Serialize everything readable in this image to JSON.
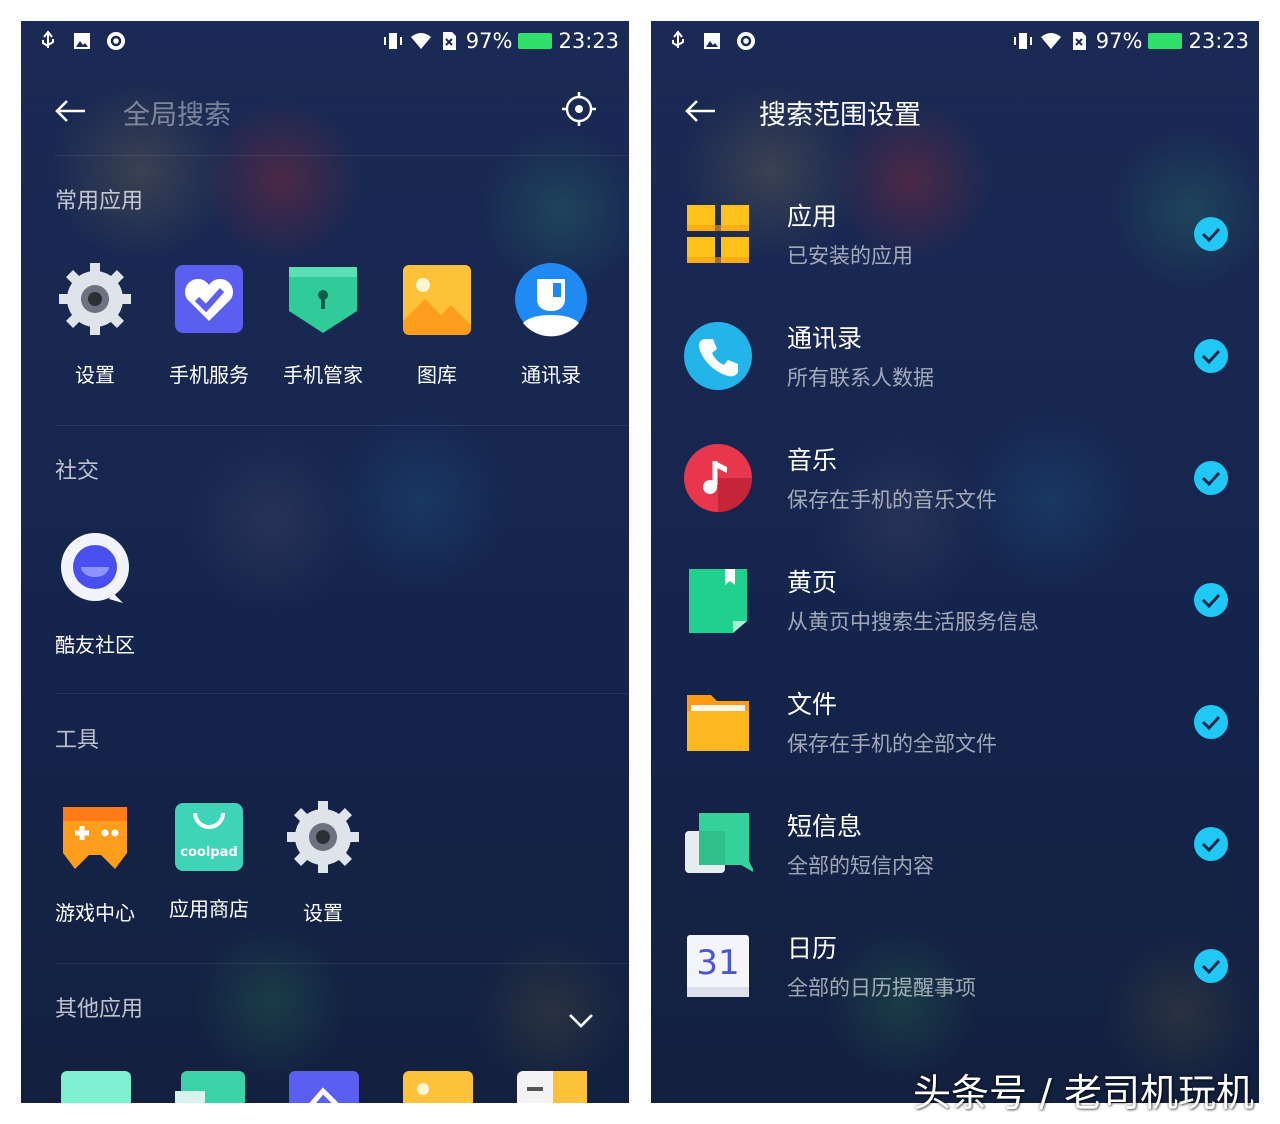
{
  "status_bar": {
    "battery": "97%",
    "time": "23:23"
  },
  "left": {
    "search_placeholder": "全局搜索",
    "sections": [
      {
        "title": "常用应用",
        "apps": [
          {
            "label": "设置",
            "icon": "settings-gear-icon"
          },
          {
            "label": "手机服务",
            "icon": "heart-check-icon"
          },
          {
            "label": "手机管家",
            "icon": "shield-lock-icon"
          },
          {
            "label": "图库",
            "icon": "gallery-icon"
          },
          {
            "label": "通讯录",
            "icon": "contacts-icon"
          }
        ]
      },
      {
        "title": "社交",
        "apps": [
          {
            "label": "酷友社区",
            "icon": "chat-bubble-icon"
          }
        ]
      },
      {
        "title": "工具",
        "apps": [
          {
            "label": "游戏中心",
            "icon": "gamepad-icon"
          },
          {
            "label": "应用商店",
            "icon": "app-store-bag-icon"
          },
          {
            "label": "设置",
            "icon": "settings-gear-icon"
          }
        ]
      },
      {
        "title": "其他应用"
      }
    ],
    "store_icon_text": "coolpad"
  },
  "right": {
    "title": "搜索范围设置",
    "items": [
      {
        "title": "应用",
        "subtitle": "已安装的应用",
        "icon": "apps-grid-icon",
        "checked": true
      },
      {
        "title": "通讯录",
        "subtitle": "所有联系人数据",
        "icon": "phone-icon",
        "checked": true
      },
      {
        "title": "音乐",
        "subtitle": "保存在手机的音乐文件",
        "icon": "music-note-icon",
        "checked": true
      },
      {
        "title": "黄页",
        "subtitle": "从黄页中搜索生活服务信息",
        "icon": "yellow-pages-book-icon",
        "checked": true
      },
      {
        "title": "文件",
        "subtitle": "保存在手机的全部文件",
        "icon": "folder-icon",
        "checked": true
      },
      {
        "title": "短信息",
        "subtitle": "全部的短信内容",
        "icon": "messages-icon",
        "checked": true
      },
      {
        "title": "日历",
        "subtitle": "全部的日历提醒事项",
        "icon": "calendar-icon",
        "checked": true
      }
    ],
    "calendar_day": "31"
  },
  "watermark": "头条号 / 老司机玩机",
  "colors": {
    "check": "#1fc8f5",
    "status_battery": "#2fe06a"
  }
}
